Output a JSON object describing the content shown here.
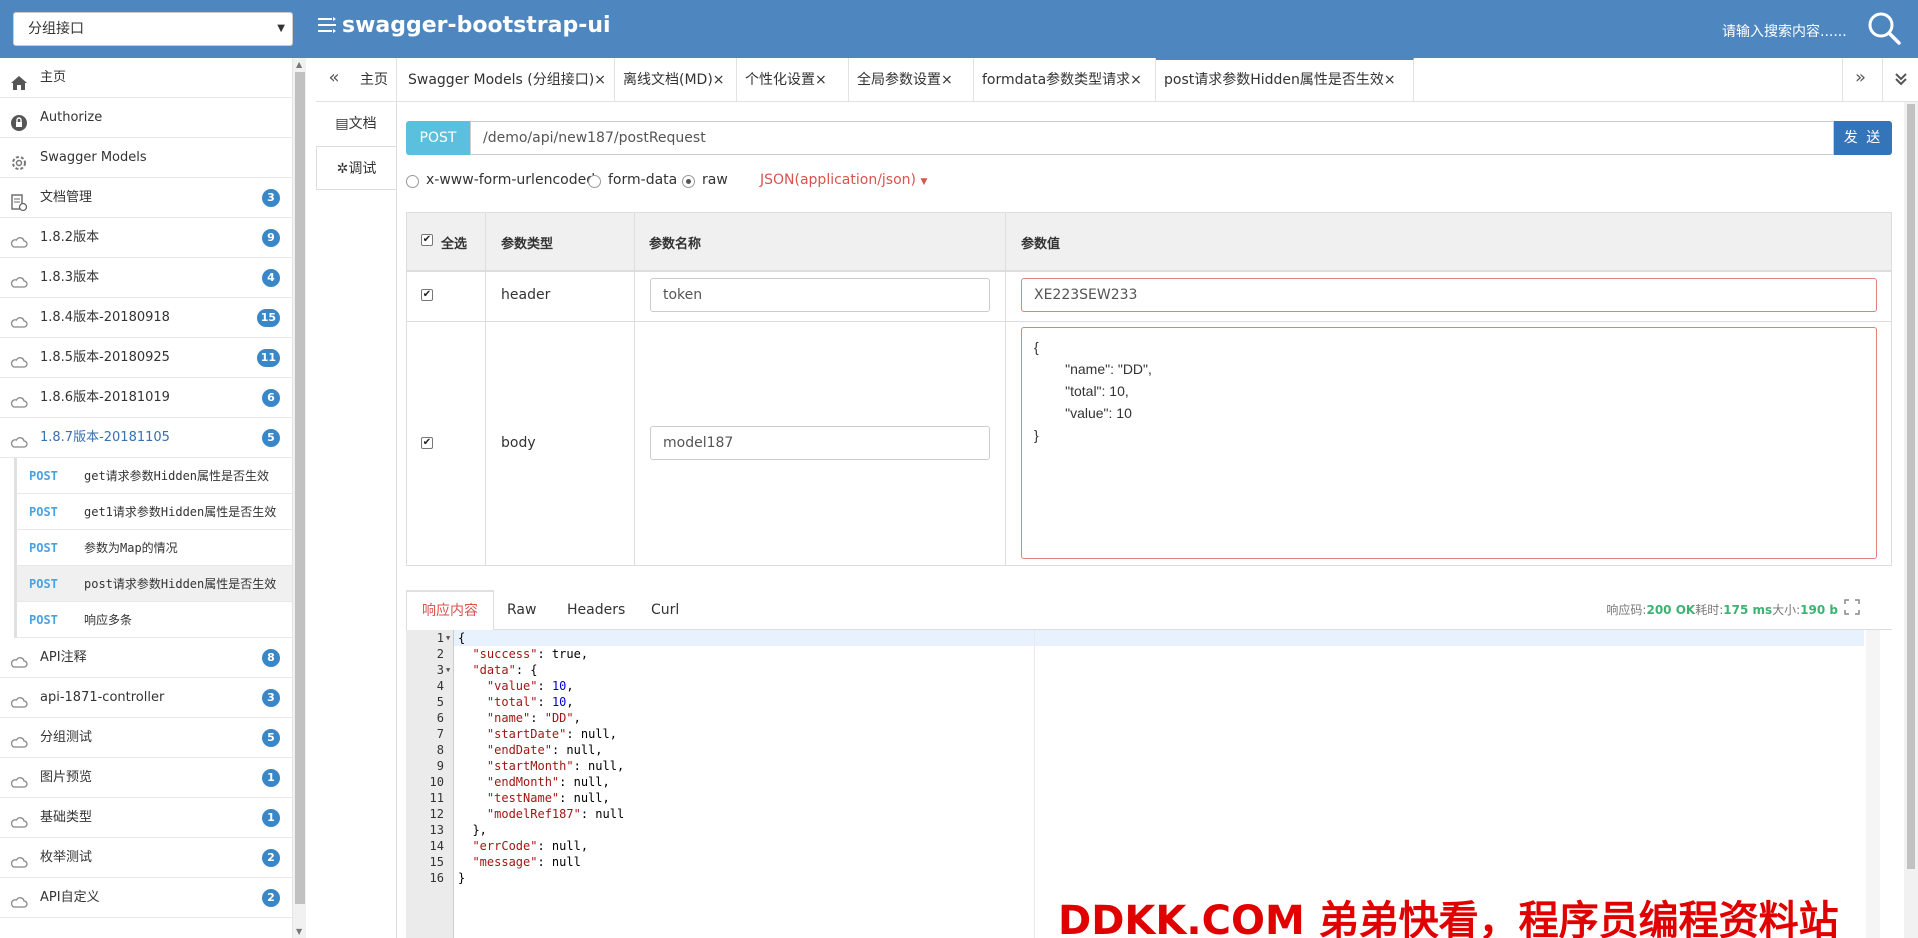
{
  "header": {
    "group_select": "分组接口",
    "brand": "swagger-bootstrap-ui",
    "search_placeholder": "请输入搜索内容......"
  },
  "sidebar": {
    "items": [
      {
        "label": "主页",
        "icon": "home-icon",
        "badge": ""
      },
      {
        "label": "Authorize",
        "icon": "lock-icon",
        "badge": ""
      },
      {
        "label": "Swagger Models",
        "icon": "gear-icon",
        "badge": ""
      },
      {
        "label": "文档管理",
        "icon": "doc-manage-icon",
        "badge": "3"
      },
      {
        "label": "1.8.2版本",
        "icon": "cloud-icon",
        "badge": "9"
      },
      {
        "label": "1.8.3版本",
        "icon": "cloud-icon",
        "badge": "4"
      },
      {
        "label": "1.8.4版本-20180918",
        "icon": "cloud-icon",
        "badge": "15"
      },
      {
        "label": "1.8.5版本-20180925",
        "icon": "cloud-icon",
        "badge": "11"
      },
      {
        "label": "1.8.6版本-20181019",
        "icon": "cloud-icon",
        "badge": "6"
      },
      {
        "label": "1.8.7版本-20181105",
        "icon": "cloud-icon",
        "badge": "5"
      }
    ],
    "sub_items": [
      {
        "method": "POST",
        "label": "get请求参数Hidden属性是否生效"
      },
      {
        "method": "POST",
        "label": "get1请求参数Hidden属性是否生效"
      },
      {
        "method": "POST",
        "label": "参数为Map的情况"
      },
      {
        "method": "POST",
        "label": "post请求参数Hidden属性是否生效"
      },
      {
        "method": "POST",
        "label": "响应多条"
      }
    ],
    "items_after": [
      {
        "label": "API注释",
        "icon": "cloud-icon",
        "badge": "8"
      },
      {
        "label": "api-1871-controller",
        "icon": "cloud-icon",
        "badge": "3"
      },
      {
        "label": "分组测试",
        "icon": "cloud-icon",
        "badge": "5"
      },
      {
        "label": "图片预览",
        "icon": "cloud-icon",
        "badge": "1"
      },
      {
        "label": "基础类型",
        "icon": "cloud-icon",
        "badge": "1"
      },
      {
        "label": "枚举测试",
        "icon": "cloud-icon",
        "badge": "2"
      },
      {
        "label": "API自定义",
        "icon": "cloud-icon",
        "badge": "2"
      }
    ]
  },
  "tabs": {
    "left_nav": "«",
    "right_nav": "»",
    "collapse": "⌄",
    "items": [
      {
        "label": "主页"
      },
      {
        "label": "Swagger Models (分组接口)×"
      },
      {
        "label": "离线文档(MD)×"
      },
      {
        "label": "个性化设置×"
      },
      {
        "label": "全局参数设置×"
      },
      {
        "label": "formdata参数类型请求×"
      },
      {
        "label": "post请求参数Hidden属性是否生效×"
      }
    ]
  },
  "vtabs": {
    "doc": "文档",
    "debug": "调试"
  },
  "request": {
    "method": "POST",
    "url": "/demo/api/new187/postRequest",
    "send": "发 送",
    "content_types": [
      "x-www-form-urlencoded",
      "form-data",
      "raw"
    ],
    "selected_content_type": "raw",
    "raw_type": "JSON(application/json)"
  },
  "params": {
    "headers": {
      "select_all": "全选",
      "type": "参数类型",
      "name": "参数名称",
      "value": "参数值"
    },
    "rows": [
      {
        "type": "header",
        "name": "token",
        "value": "XE223SEW233",
        "checked": true
      },
      {
        "type": "body",
        "name": "model187",
        "value": "{\n        \"name\": \"DD\",\n        \"total\": 10,\n        \"value\": 10\n}",
        "checked": true
      }
    ]
  },
  "response": {
    "tabs": [
      "响应内容",
      "Raw",
      "Headers",
      "Curl"
    ],
    "active_tab": "响应内容",
    "meta": {
      "code_label": "响应码:",
      "code": "200 OK",
      "time_label": "耗时:",
      "time": "175 ms",
      "size_label": "大小:",
      "size": "190 b"
    },
    "lines": [
      "{",
      "  \"success\": true,",
      "  \"data\": {",
      "    \"value\": 10,",
      "    \"total\": 10,",
      "    \"name\": \"DD\",",
      "    \"startDate\": null,",
      "    \"endDate\": null,",
      "    \"startMonth\": null,",
      "    \"endMonth\": null,",
      "    \"testName\": null,",
      "    \"modelRef187\": null",
      "  },",
      "  \"errCode\": null,",
      "  \"message\": null",
      "}"
    ]
  },
  "watermark": "DDKK.COM 弟弟快看，程序员编程资料站",
  "colors": {
    "header_bg": "#4e86c0",
    "badge": "#3a87c8",
    "method_post": "#5bc0de",
    "send": "#3474b8",
    "watermark": "#e00000"
  }
}
